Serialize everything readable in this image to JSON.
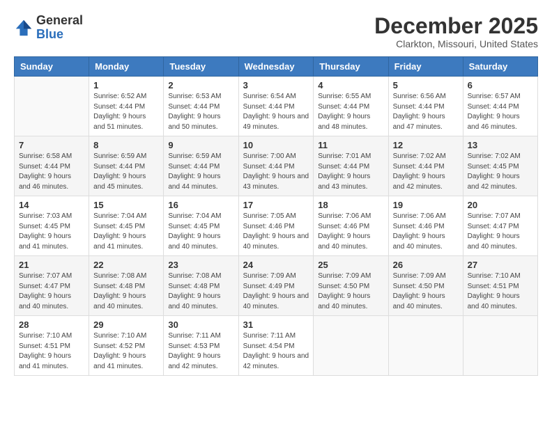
{
  "header": {
    "logo_general": "General",
    "logo_blue": "Blue",
    "month_title": "December 2025",
    "location": "Clarkton, Missouri, United States"
  },
  "weekdays": [
    "Sunday",
    "Monday",
    "Tuesday",
    "Wednesday",
    "Thursday",
    "Friday",
    "Saturday"
  ],
  "weeks": [
    [
      {
        "num": "",
        "sunrise": "",
        "sunset": "",
        "daylight": ""
      },
      {
        "num": "1",
        "sunrise": "Sunrise: 6:52 AM",
        "sunset": "Sunset: 4:44 PM",
        "daylight": "Daylight: 9 hours and 51 minutes."
      },
      {
        "num": "2",
        "sunrise": "Sunrise: 6:53 AM",
        "sunset": "Sunset: 4:44 PM",
        "daylight": "Daylight: 9 hours and 50 minutes."
      },
      {
        "num": "3",
        "sunrise": "Sunrise: 6:54 AM",
        "sunset": "Sunset: 4:44 PM",
        "daylight": "Daylight: 9 hours and 49 minutes."
      },
      {
        "num": "4",
        "sunrise": "Sunrise: 6:55 AM",
        "sunset": "Sunset: 4:44 PM",
        "daylight": "Daylight: 9 hours and 48 minutes."
      },
      {
        "num": "5",
        "sunrise": "Sunrise: 6:56 AM",
        "sunset": "Sunset: 4:44 PM",
        "daylight": "Daylight: 9 hours and 47 minutes."
      },
      {
        "num": "6",
        "sunrise": "Sunrise: 6:57 AM",
        "sunset": "Sunset: 4:44 PM",
        "daylight": "Daylight: 9 hours and 46 minutes."
      }
    ],
    [
      {
        "num": "7",
        "sunrise": "Sunrise: 6:58 AM",
        "sunset": "Sunset: 4:44 PM",
        "daylight": "Daylight: 9 hours and 46 minutes."
      },
      {
        "num": "8",
        "sunrise": "Sunrise: 6:59 AM",
        "sunset": "Sunset: 4:44 PM",
        "daylight": "Daylight: 9 hours and 45 minutes."
      },
      {
        "num": "9",
        "sunrise": "Sunrise: 6:59 AM",
        "sunset": "Sunset: 4:44 PM",
        "daylight": "Daylight: 9 hours and 44 minutes."
      },
      {
        "num": "10",
        "sunrise": "Sunrise: 7:00 AM",
        "sunset": "Sunset: 4:44 PM",
        "daylight": "Daylight: 9 hours and 43 minutes."
      },
      {
        "num": "11",
        "sunrise": "Sunrise: 7:01 AM",
        "sunset": "Sunset: 4:44 PM",
        "daylight": "Daylight: 9 hours and 43 minutes."
      },
      {
        "num": "12",
        "sunrise": "Sunrise: 7:02 AM",
        "sunset": "Sunset: 4:44 PM",
        "daylight": "Daylight: 9 hours and 42 minutes."
      },
      {
        "num": "13",
        "sunrise": "Sunrise: 7:02 AM",
        "sunset": "Sunset: 4:45 PM",
        "daylight": "Daylight: 9 hours and 42 minutes."
      }
    ],
    [
      {
        "num": "14",
        "sunrise": "Sunrise: 7:03 AM",
        "sunset": "Sunset: 4:45 PM",
        "daylight": "Daylight: 9 hours and 41 minutes."
      },
      {
        "num": "15",
        "sunrise": "Sunrise: 7:04 AM",
        "sunset": "Sunset: 4:45 PM",
        "daylight": "Daylight: 9 hours and 41 minutes."
      },
      {
        "num": "16",
        "sunrise": "Sunrise: 7:04 AM",
        "sunset": "Sunset: 4:45 PM",
        "daylight": "Daylight: 9 hours and 40 minutes."
      },
      {
        "num": "17",
        "sunrise": "Sunrise: 7:05 AM",
        "sunset": "Sunset: 4:46 PM",
        "daylight": "Daylight: 9 hours and 40 minutes."
      },
      {
        "num": "18",
        "sunrise": "Sunrise: 7:06 AM",
        "sunset": "Sunset: 4:46 PM",
        "daylight": "Daylight: 9 hours and 40 minutes."
      },
      {
        "num": "19",
        "sunrise": "Sunrise: 7:06 AM",
        "sunset": "Sunset: 4:46 PM",
        "daylight": "Daylight: 9 hours and 40 minutes."
      },
      {
        "num": "20",
        "sunrise": "Sunrise: 7:07 AM",
        "sunset": "Sunset: 4:47 PM",
        "daylight": "Daylight: 9 hours and 40 minutes."
      }
    ],
    [
      {
        "num": "21",
        "sunrise": "Sunrise: 7:07 AM",
        "sunset": "Sunset: 4:47 PM",
        "daylight": "Daylight: 9 hours and 40 minutes."
      },
      {
        "num": "22",
        "sunrise": "Sunrise: 7:08 AM",
        "sunset": "Sunset: 4:48 PM",
        "daylight": "Daylight: 9 hours and 40 minutes."
      },
      {
        "num": "23",
        "sunrise": "Sunrise: 7:08 AM",
        "sunset": "Sunset: 4:48 PM",
        "daylight": "Daylight: 9 hours and 40 minutes."
      },
      {
        "num": "24",
        "sunrise": "Sunrise: 7:09 AM",
        "sunset": "Sunset: 4:49 PM",
        "daylight": "Daylight: 9 hours and 40 minutes."
      },
      {
        "num": "25",
        "sunrise": "Sunrise: 7:09 AM",
        "sunset": "Sunset: 4:50 PM",
        "daylight": "Daylight: 9 hours and 40 minutes."
      },
      {
        "num": "26",
        "sunrise": "Sunrise: 7:09 AM",
        "sunset": "Sunset: 4:50 PM",
        "daylight": "Daylight: 9 hours and 40 minutes."
      },
      {
        "num": "27",
        "sunrise": "Sunrise: 7:10 AM",
        "sunset": "Sunset: 4:51 PM",
        "daylight": "Daylight: 9 hours and 40 minutes."
      }
    ],
    [
      {
        "num": "28",
        "sunrise": "Sunrise: 7:10 AM",
        "sunset": "Sunset: 4:51 PM",
        "daylight": "Daylight: 9 hours and 41 minutes."
      },
      {
        "num": "29",
        "sunrise": "Sunrise: 7:10 AM",
        "sunset": "Sunset: 4:52 PM",
        "daylight": "Daylight: 9 hours and 41 minutes."
      },
      {
        "num": "30",
        "sunrise": "Sunrise: 7:11 AM",
        "sunset": "Sunset: 4:53 PM",
        "daylight": "Daylight: 9 hours and 42 minutes."
      },
      {
        "num": "31",
        "sunrise": "Sunrise: 7:11 AM",
        "sunset": "Sunset: 4:54 PM",
        "daylight": "Daylight: 9 hours and 42 minutes."
      },
      {
        "num": "",
        "sunrise": "",
        "sunset": "",
        "daylight": ""
      },
      {
        "num": "",
        "sunrise": "",
        "sunset": "",
        "daylight": ""
      },
      {
        "num": "",
        "sunrise": "",
        "sunset": "",
        "daylight": ""
      }
    ]
  ]
}
